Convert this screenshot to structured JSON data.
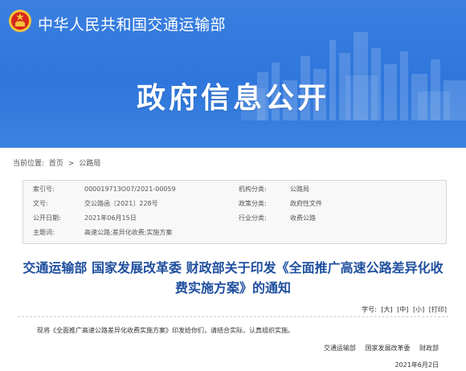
{
  "site": {
    "name": "中华人民共和国交通运输部"
  },
  "portal": {
    "title": "政府信息公开"
  },
  "breadcrumb": {
    "prefix": "当前位置:",
    "items": [
      "首页",
      "公路局"
    ],
    "separator": ">"
  },
  "metadata": {
    "index_label": "索引号:",
    "index_value": "000019713O07/2021-00059",
    "org_label": "机构分类:",
    "org_value": "公路局",
    "docno_label": "文号:",
    "docno_value": "交公路函〔2021〕228号",
    "nature_label": "政策分类:",
    "nature_value": "政府性文件",
    "date_label": "公开日期:",
    "date_value": "2021年06月15日",
    "industry_label": "行业分类:",
    "industry_value": "收费公路",
    "subject_label": "主题词:",
    "subject_value": "高速公路;差异化收费;实施方案"
  },
  "document": {
    "title_line1": "交通运输部 国家发展改革委 财政部关于印发《全面推广高速公路差异化收",
    "title_line2": "费实施方案》的通知",
    "intro": "现将《全面推广高速公路差异化收费实施方案》印发给你们，请结合实际，认真组织实施。",
    "signers": [
      "交通运输部",
      "国家发展改革委",
      "财政部"
    ],
    "date": "2021年6月2日"
  },
  "toolbar": {
    "font_label": "字号:",
    "large": "[大]",
    "medium": "[中]",
    "small": "[小]",
    "print": "[打印]"
  },
  "colors": {
    "banner": "#3a7fe0",
    "title_blue": "#1f4f9e",
    "emblem_red": "#d7261e",
    "emblem_gold": "#f4c43a"
  }
}
